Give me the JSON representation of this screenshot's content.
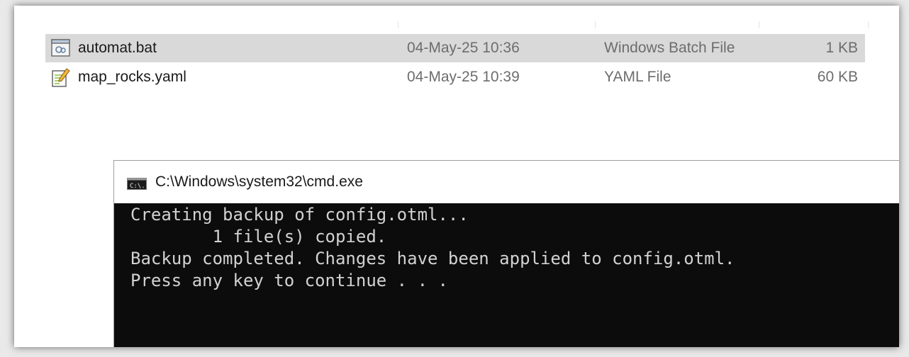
{
  "files": [
    {
      "name": "automat.bat",
      "date": "04-May-25 10:36",
      "type": "Windows Batch File",
      "size": "1 KB",
      "icon": "batch-file-icon",
      "selected": true
    },
    {
      "name": "map_rocks.yaml",
      "date": "04-May-25 10:39",
      "type": "YAML File",
      "size": "60 KB",
      "icon": "text-file-icon",
      "selected": false
    }
  ],
  "cmd": {
    "title": "C:\\Windows\\system32\\cmd.exe",
    "icon": "cmd-icon",
    "icon_label": "C:\\.",
    "lines": [
      "Creating backup of config.otml...",
      "        1 file(s) copied.",
      "Backup completed. Changes have been applied to config.otml.",
      "Press any key to continue . . ."
    ]
  },
  "colors": {
    "selection": "#d9d9d9",
    "console_bg": "#0c0c0c",
    "console_text": "#d2d2d2",
    "secondary_text": "#6d6d6d"
  }
}
